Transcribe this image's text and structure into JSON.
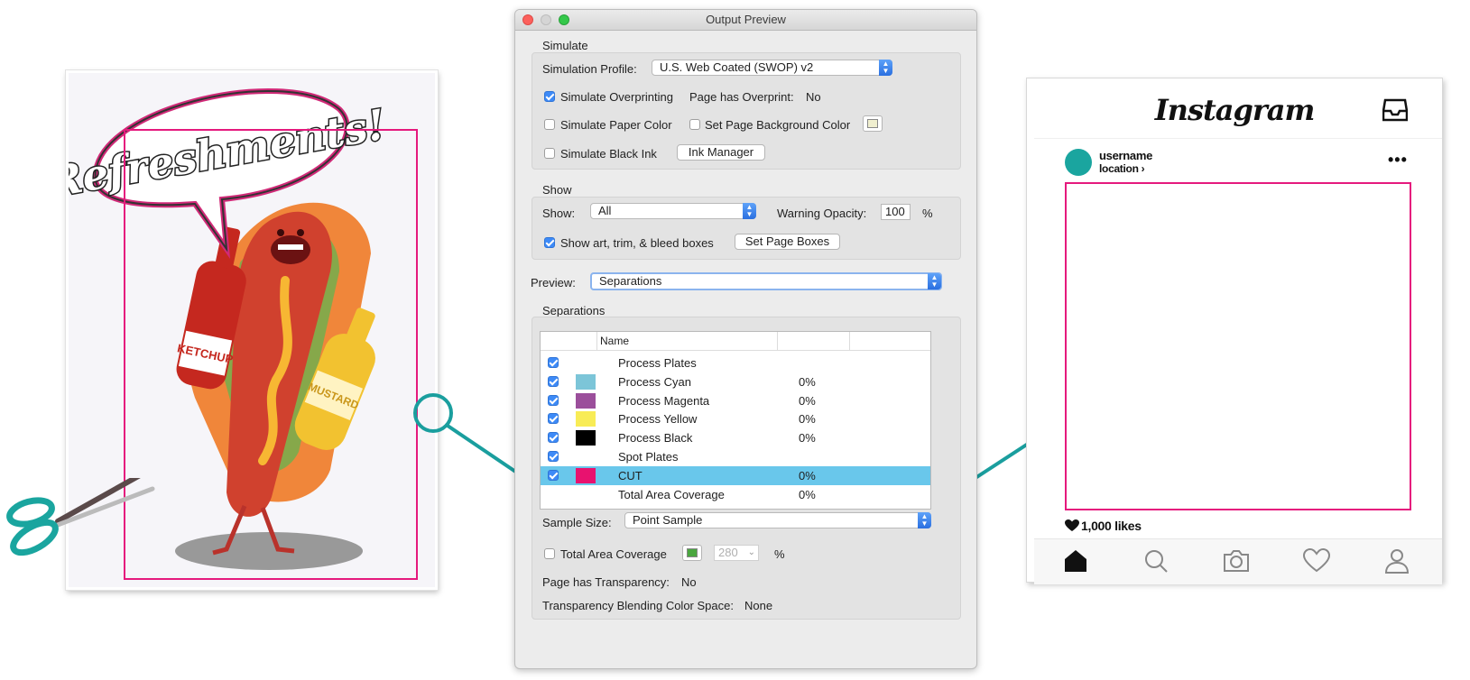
{
  "poster": {
    "headline": "Refreshments!",
    "ketchup_label": "KETCHUP",
    "mustard_label": "MUSTARD"
  },
  "dialog": {
    "title": "Output Preview",
    "simulate": {
      "group_label": "Simulate",
      "profile_label": "Simulation Profile:",
      "profile_value": "U.S. Web Coated (SWOP) v2",
      "overprinting_label": "Simulate Overprinting",
      "overprinting_checked": true,
      "overprint_status_label": "Page has Overprint:",
      "overprint_status_value": "No",
      "paper_color_label": "Simulate Paper Color",
      "paper_color_checked": false,
      "page_bg_label": "Set Page Background Color",
      "page_bg_checked": false,
      "page_bg_swatch": "#f0efcf",
      "black_ink_label": "Simulate Black Ink",
      "black_ink_checked": false,
      "ink_manager_label": "Ink Manager"
    },
    "show": {
      "group_label": "Show",
      "show_label": "Show:",
      "show_value": "All",
      "opacity_label": "Warning Opacity:",
      "opacity_value": "100",
      "opacity_unit": "%",
      "boxes_label": "Show art, trim, & bleed boxes",
      "boxes_checked": true,
      "set_boxes_label": "Set Page Boxes"
    },
    "preview": {
      "label": "Preview:",
      "value": "Separations"
    },
    "separations": {
      "group_label": "Separations",
      "name_header": "Name",
      "rows": [
        {
          "name": "Process Plates",
          "value": "",
          "color": "",
          "checked": true,
          "selected": false
        },
        {
          "name": "Process Cyan",
          "value": "0%",
          "color": "#7cc5d8",
          "checked": true,
          "selected": false
        },
        {
          "name": "Process Magenta",
          "value": "0%",
          "color": "#9b4f9b",
          "checked": true,
          "selected": false
        },
        {
          "name": "Process Yellow",
          "value": "0%",
          "color": "#f8ec56",
          "checked": true,
          "selected": false
        },
        {
          "name": "Process Black",
          "value": "0%",
          "color": "#000000",
          "checked": true,
          "selected": false
        },
        {
          "name": "Spot Plates",
          "value": "",
          "color": "",
          "checked": true,
          "selected": false
        },
        {
          "name": "CUT",
          "value": "0%",
          "color": "#e8126f",
          "checked": true,
          "selected": true
        },
        {
          "name": "Total Area Coverage",
          "value": "0%",
          "color": "",
          "checked": false,
          "selected": false
        }
      ]
    },
    "sample": {
      "label": "Sample Size:",
      "value": "Point Sample"
    },
    "coverage": {
      "label": "Total Area Coverage",
      "checked": false,
      "swatch": "#4aa63f",
      "value": "280",
      "unit": "%"
    },
    "transparency": {
      "label": "Page has Transparency:",
      "value": "No"
    },
    "blending": {
      "label": "Transparency Blending Color Space:",
      "value": "None"
    }
  },
  "instagram": {
    "logo": "Instagram",
    "username": "username",
    "location": "location",
    "location_chevron": "›",
    "more": "•••",
    "likes": "1,000 likes"
  },
  "colors": {
    "cut_line": "#e5197d",
    "connector": "#1a9e9e",
    "selected_row": "#69c7eb"
  }
}
